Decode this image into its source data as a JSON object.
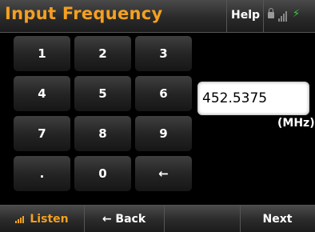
{
  "header": {
    "title": "Input Frequency",
    "help_label": "Help",
    "icons": [
      "lock-icon",
      "signal-icon",
      "power-icon"
    ]
  },
  "keypad": {
    "keys": [
      "1",
      "2",
      "3",
      "4",
      "5",
      "6",
      "7",
      "8",
      "9",
      ".",
      "0",
      "←"
    ]
  },
  "frequency": {
    "value": "452.5375",
    "unit": "(MHz)"
  },
  "footer": {
    "listen_label": "Listen",
    "back_label": "← Back",
    "next_label": "Next"
  },
  "colors": {
    "accent": "#f5a020",
    "background": "#000000",
    "status_bolt": "#2fd22f"
  }
}
